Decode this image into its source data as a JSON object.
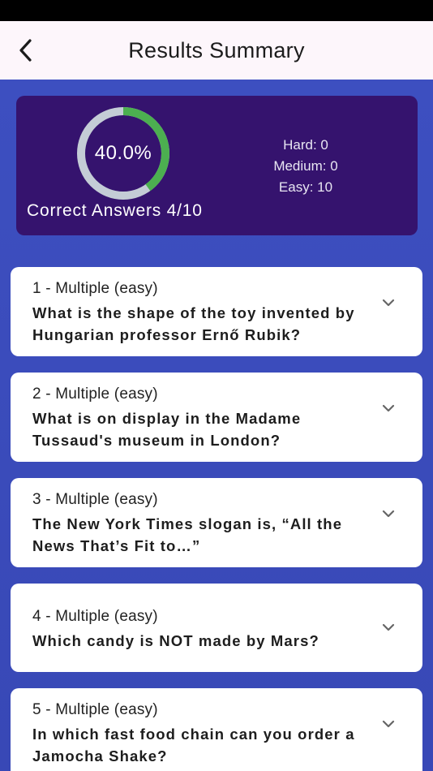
{
  "header": {
    "title": "Results Summary"
  },
  "summary": {
    "percent_label": "40.0%",
    "percent_value": 0.4,
    "correct_label": "Correct Answers 4/10",
    "difficulty": {
      "hard": "Hard: 0",
      "medium": "Medium: 0",
      "easy": "Easy: 10"
    }
  },
  "colors": {
    "ring_progress": "#4caf50",
    "ring_track": "#c4ccd6",
    "card_bg": "#35136e",
    "page_bg": "#3d4fc0"
  },
  "questions": [
    {
      "meta": "1 - Multiple (easy)",
      "text": "What is the shape of the toy invented by Hungarian professor Ernő Rubik?"
    },
    {
      "meta": "2 - Multiple (easy)",
      "text": "What is on display in the Madame Tussaud's museum in London?"
    },
    {
      "meta": "3 - Multiple (easy)",
      "text": "The New York Times slogan is, “All the News That’s Fit to…”"
    },
    {
      "meta": "4 - Multiple (easy)",
      "text": "Which candy is NOT made by Mars?"
    },
    {
      "meta": "5 - Multiple (easy)",
      "text": "In which fast food chain can you order a Jamocha Shake?"
    }
  ],
  "icons": {
    "back": "chevron-left-icon",
    "expand": "chevron-down-icon"
  }
}
